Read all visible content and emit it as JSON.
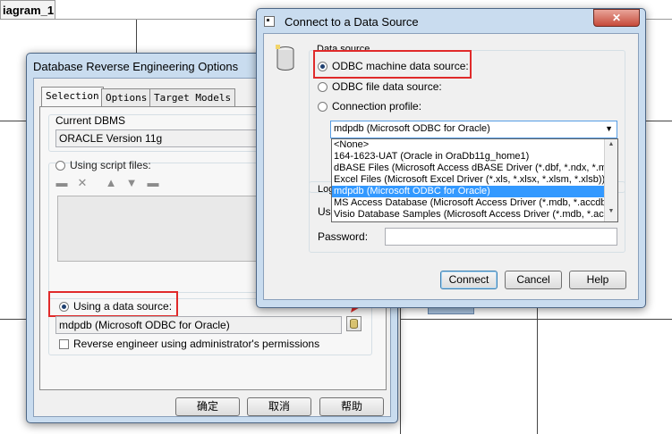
{
  "diagram": {
    "tab_label": "iagram_1"
  },
  "reverse_dialog": {
    "title": "Database Reverse Engineering Options",
    "tabs": [
      {
        "label": "Selection"
      },
      {
        "label": "Options"
      },
      {
        "label": "Target Models"
      }
    ],
    "current_dbms_label": "Current DBMS",
    "current_dbms_value": "ORACLE Version 11g",
    "script_files_label": "Using script files:",
    "data_source_label": "Using a data source:",
    "data_source_value": "mdpdb (Microsoft ODBC for Oracle)",
    "admin_label": "Reverse engineer using administrator's permissions",
    "ok_label": "确定",
    "cancel_label": "取消",
    "help_label": "帮助"
  },
  "connect_dialog": {
    "title": "Connect to a Data Source",
    "close_glyph": "✕",
    "data_source_group_label": "Data source",
    "odbc_machine_label": "ODBC machine data source:",
    "odbc_file_label": "ODBC file data source:",
    "connection_profile_label": "Connection profile:",
    "selected_source": "mdpdb (Microsoft ODBC for Oracle)",
    "dropdown_options": [
      "<None>",
      "164-1623-UAT (Oracle in OraDb11g_home1)",
      "dBASE Files (Microsoft Access dBASE Driver (*.dbf, *.ndx, *.mdx",
      "Excel Files (Microsoft Excel Driver (*.xls, *.xlsx, *.xlsm, *.xlsb))",
      "mdpdb (Microsoft ODBC for Oracle)",
      "MS Access Database (Microsoft Access Driver (*.mdb, *.accdb))",
      "Visio Database Samples (Microsoft Access Driver (*.mdb, *.accd"
    ],
    "login_label": "Log",
    "user_label": "Use",
    "password_label": "Password:",
    "connect_label": "Connect",
    "cancel_label": "Cancel",
    "help_label": "Help"
  },
  "colors": {
    "highlight_red": "#e02a2a",
    "selection_blue": "#3399ff",
    "window_frame": "#c9dcef"
  }
}
